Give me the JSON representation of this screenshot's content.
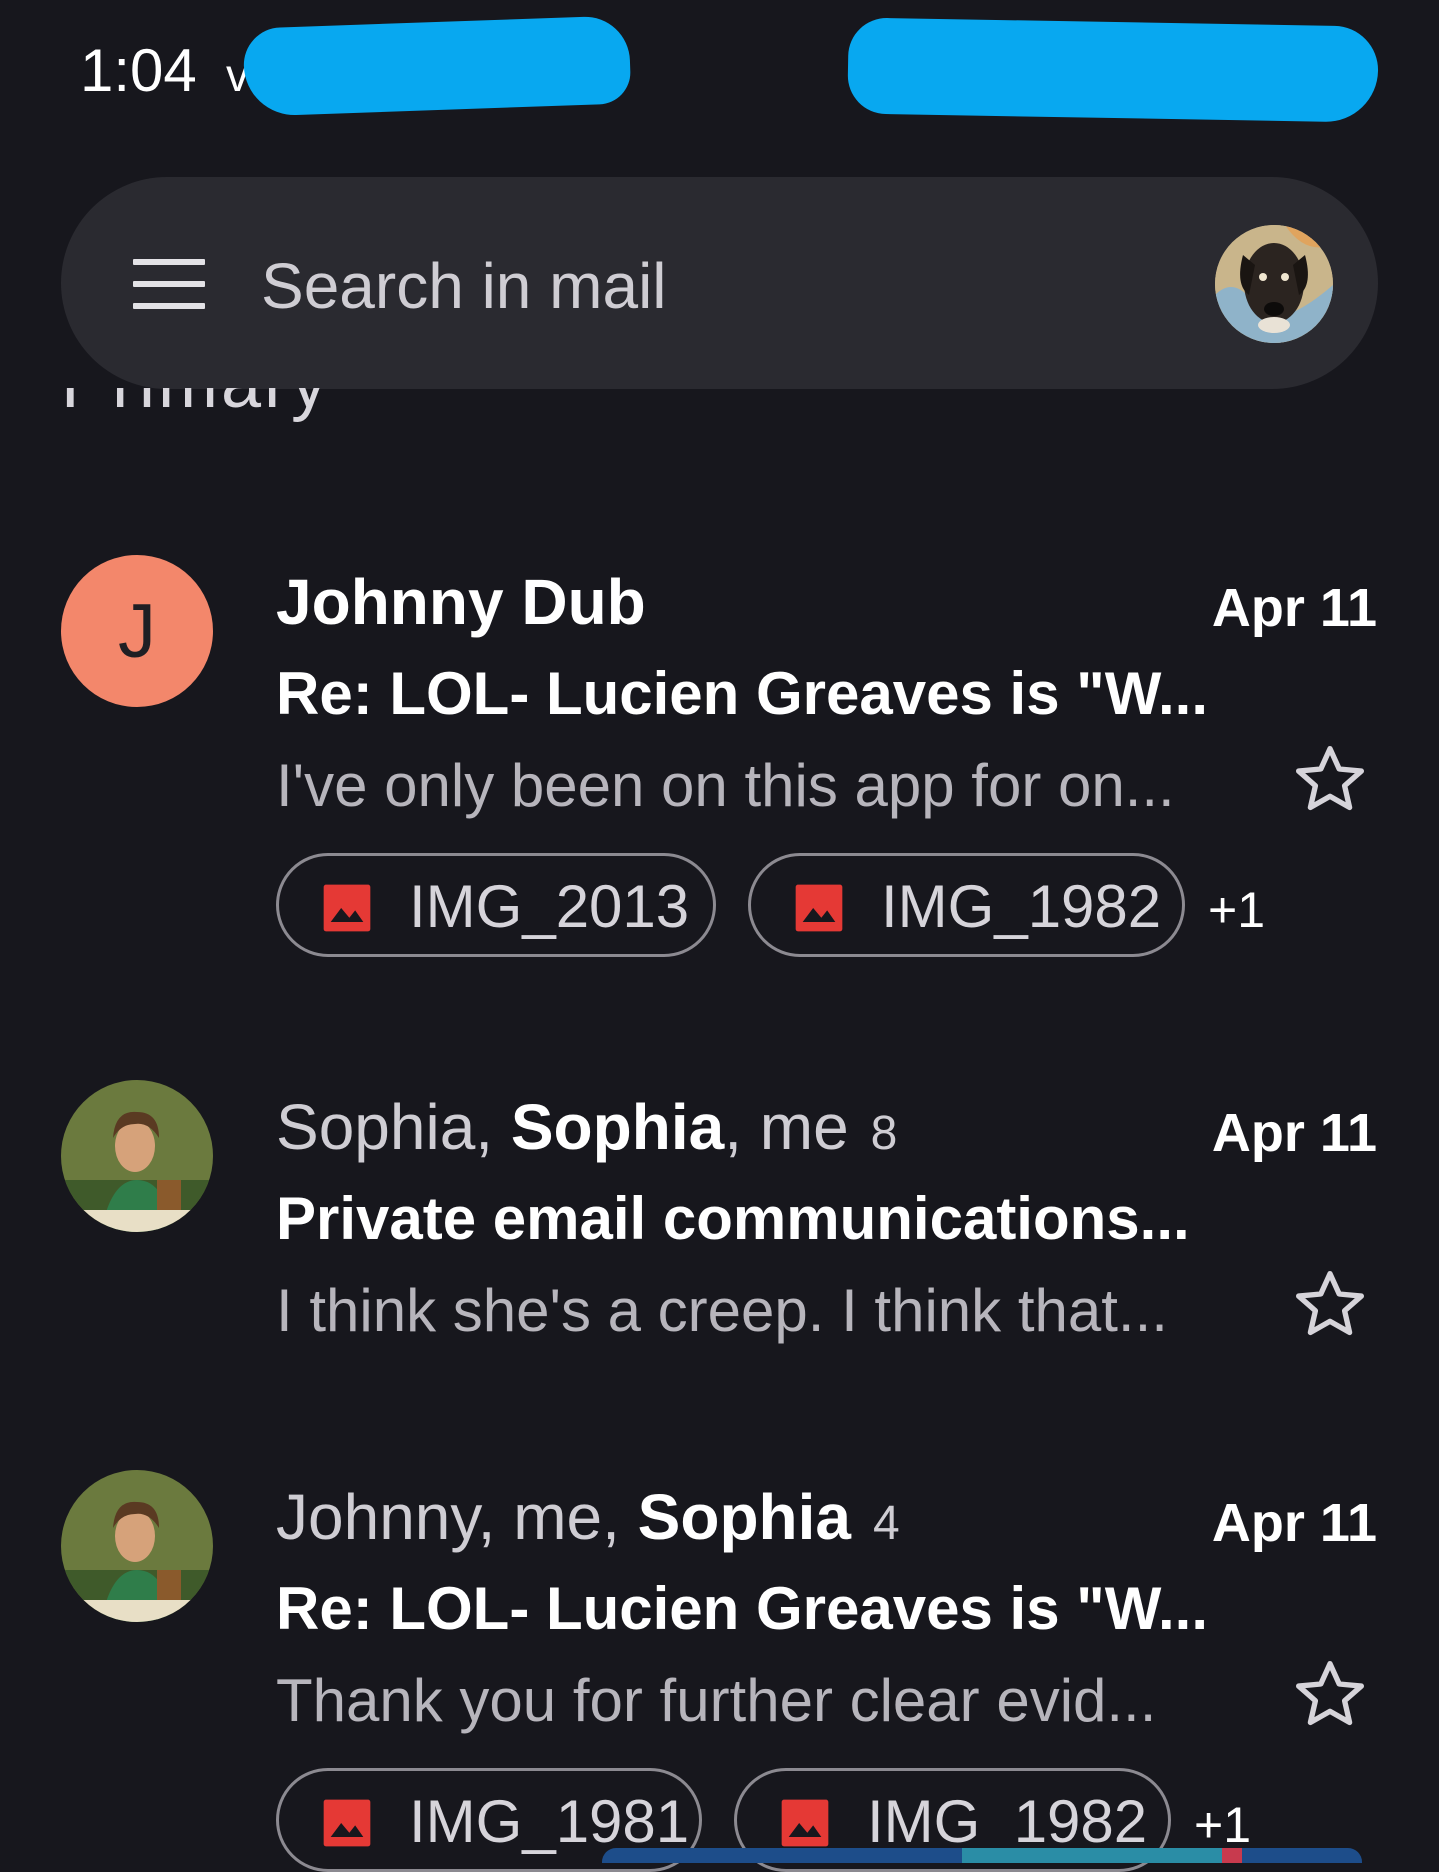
{
  "status_bar": {
    "time": "1:04",
    "extra": "v"
  },
  "search": {
    "placeholder": "Search in mail"
  },
  "section_label": "Primary",
  "emails": [
    {
      "avatar_letter": "J",
      "avatar_color": "#f3876b",
      "sender_text": "Johnny Dub",
      "date": "Apr 11",
      "subject": "Re: LOL- Lucien Greaves is \"W...",
      "snippet": "I've only been on this app for on...",
      "attachments": [
        "IMG_2013",
        "IMG_1982"
      ],
      "more_attachments": "+1"
    },
    {
      "avatar": "painting-portrait",
      "sender_parts": [
        "Sophia, ",
        "Sophia",
        ", me"
      ],
      "count": "8",
      "date": "Apr 11",
      "subject": "Private email communications...",
      "snippet": "I think she's a creep. I think that..."
    },
    {
      "avatar": "painting-portrait",
      "sender_parts": [
        "Johnny, me, ",
        "Sophia"
      ],
      "count": "4",
      "date": "Apr 11",
      "subject": "Re: LOL- Lucien Greaves is \"W...",
      "snippet": "Thank you for further clear evid...",
      "attachments": [
        "IMG_1981",
        "IMG_1982"
      ],
      "more_attachments": "+1"
    }
  ],
  "colors": {
    "background": "#17171d",
    "search_bar": "#2a2a30",
    "attachment_icon": "#e53935",
    "redaction": "#08a8f0"
  }
}
